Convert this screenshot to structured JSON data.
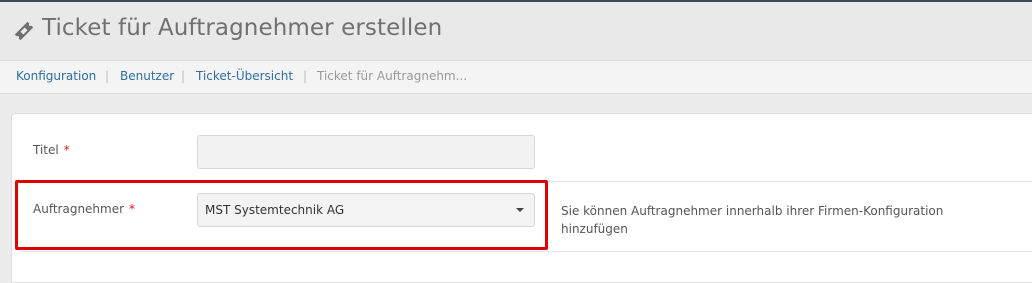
{
  "page": {
    "title": "Ticket für Auftragnehmer erstellen",
    "title_icon": "ticket-icon"
  },
  "breadcrumb": {
    "items": [
      {
        "label": "Konfiguration"
      },
      {
        "label": "Benutzer"
      },
      {
        "label": "Ticket-Übersicht"
      }
    ],
    "current": "Ticket für Auftragnehm...",
    "separator": "|"
  },
  "form": {
    "title_field": {
      "label": "Titel",
      "required_mark": "*",
      "value": ""
    },
    "contractor_field": {
      "label": "Auftragnehmer",
      "required_mark": "*",
      "selected": "MST Systemtechnik AG",
      "help_text": "Sie können Auftragnehmer innerhalb ihrer Firmen-Konfiguration hinzufügen"
    }
  },
  "colors": {
    "link": "#2f6e9f",
    "required": "#d41818",
    "highlight": "#e00000"
  }
}
